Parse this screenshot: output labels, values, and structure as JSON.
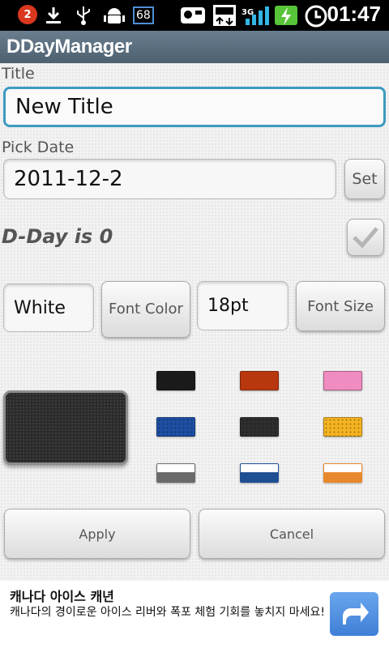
{
  "status_bar": {
    "notification_count": "2",
    "battery_level": "68",
    "network": "3G",
    "time": "01:47"
  },
  "app": {
    "title": "DDayManager"
  },
  "form": {
    "title_label": "Title",
    "title_value": "New Title",
    "date_label": "Pick Date",
    "date_value": "2011-12-2",
    "set_label": "Set",
    "dday_text": "D-Day is 0",
    "dday_checked": true,
    "font_color_value": "White",
    "font_color_button": "Font Color",
    "font_size_value": "18pt",
    "font_size_button": "Font Size"
  },
  "palette": {
    "preview_color": "#2b2b2b",
    "swatches": [
      {
        "name": "black",
        "color": "#1a1a1a"
      },
      {
        "name": "rust",
        "color": "#b8370f"
      },
      {
        "name": "pink",
        "color": "#f08cc0"
      },
      {
        "name": "blue",
        "color": "#1d4fa3"
      },
      {
        "name": "dark-gray",
        "color": "#2e2e2e"
      },
      {
        "name": "yellow",
        "color": "#f4b321"
      },
      {
        "name": "gray-white",
        "color": "#6a6a6a"
      },
      {
        "name": "navy-white",
        "color": "#1f4f93"
      },
      {
        "name": "orange-white",
        "color": "#e8882c"
      }
    ]
  },
  "actions": {
    "apply": "Apply",
    "cancel": "Cancel"
  },
  "ad": {
    "title": "캐나다 아이스 캐년",
    "body": "캐나다의 경이로운 아이스 리버와 폭포 체험 기회를 놓치지 마세요!",
    "arrow_color": "#3f7fd6"
  }
}
